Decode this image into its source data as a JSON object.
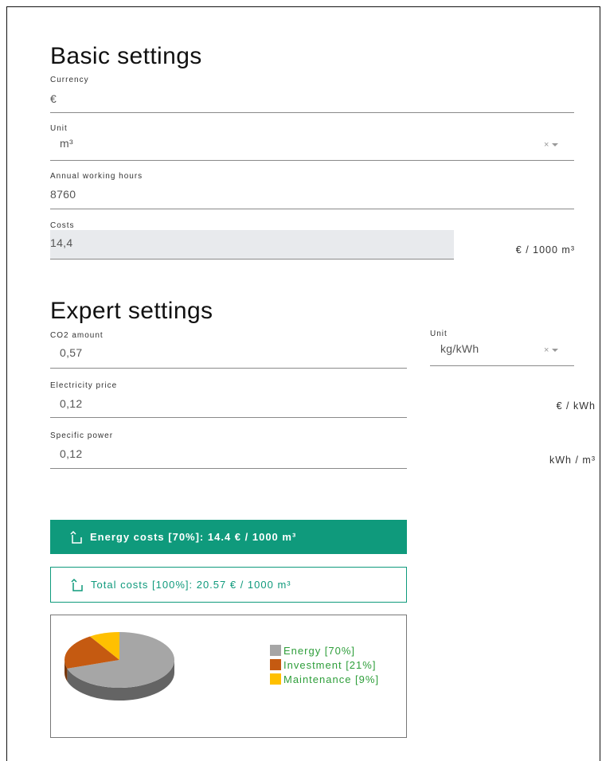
{
  "basic": {
    "title": "Basic settings",
    "currency_label": "Currency",
    "currency_value": "€",
    "unit_label": "Unit",
    "unit_value": "m³",
    "hours_label": "Annual working hours",
    "hours_value": "8760",
    "costs_label": "Costs",
    "costs_value": "14,4",
    "costs_unit": "€ / 1000 m³"
  },
  "expert": {
    "title": "Expert settings",
    "co2_label": "CO2 amount",
    "co2_value": "0,57",
    "co2_unit_label": "Unit",
    "co2_unit_value": "kg/kWh",
    "price_label": "Electricity price",
    "price_value": "0,12",
    "price_unit": "€ / kWh",
    "power_label": "Specific power",
    "power_value": "0,12",
    "power_unit": "kWh / m³"
  },
  "results": {
    "energy_button": "Energy costs [70%]: 14.4 € / 1000 m³",
    "total_button": "Total costs [100%]: 20.57 € / 1000 m³"
  },
  "colors": {
    "accent": "#0f9a7c",
    "legend_text": "#2e9e3a",
    "energy": "#a6a6a6",
    "investment": "#c55a11",
    "maintenance": "#ffc000"
  },
  "chart_data": {
    "type": "pie",
    "categories": [
      "Energy [70%]",
      "Investment [21%]",
      "Maintenance [9%]"
    ],
    "values": [
      70,
      21,
      9
    ],
    "colors": [
      "#a6a6a6",
      "#c55a11",
      "#ffc000"
    ],
    "legend": "right",
    "style": "3d"
  }
}
